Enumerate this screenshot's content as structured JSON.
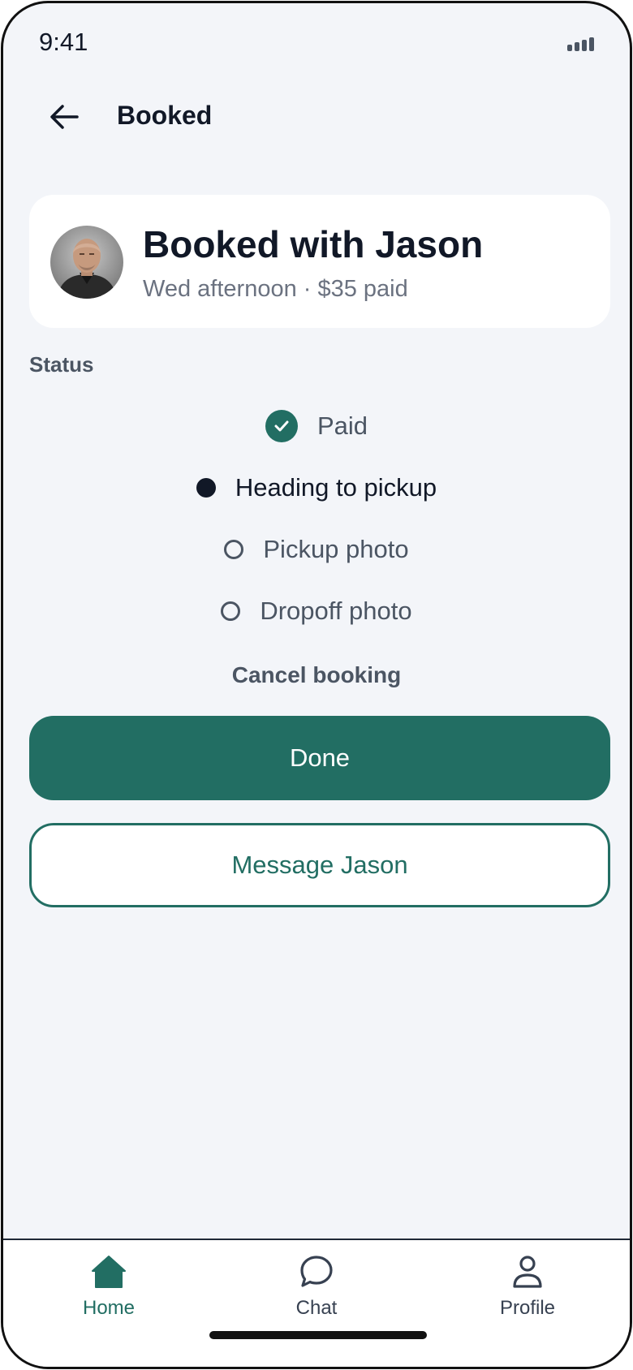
{
  "status_bar": {
    "time": "9:41",
    "signal_icon": "signal-bars-icon"
  },
  "header": {
    "back_icon": "arrow-left-icon",
    "title": "Booked"
  },
  "booking_card": {
    "title": "Booked with Jason",
    "subtitle": "Wed afternoon · $35 paid"
  },
  "status_section": {
    "label": "Status",
    "steps": [
      {
        "label": "Paid",
        "state": "done"
      },
      {
        "label": "Heading to pickup",
        "state": "current"
      },
      {
        "label": "Pickup photo",
        "state": "pending"
      },
      {
        "label": "Dropoff photo",
        "state": "pending"
      }
    ]
  },
  "actions": {
    "cancel_label": "Cancel booking",
    "done_label": "Done",
    "message_label": "Message Jason"
  },
  "tab_bar": {
    "tabs": [
      {
        "label": "Home",
        "icon": "home-icon",
        "active": true
      },
      {
        "label": "Chat",
        "icon": "chat-bubble-icon",
        "active": false
      },
      {
        "label": "Profile",
        "icon": "person-icon",
        "active": false
      }
    ]
  },
  "colors": {
    "accent": "#226e63",
    "background": "#f3f5f9",
    "text_primary": "#111827",
    "text_secondary": "#6b7280"
  }
}
